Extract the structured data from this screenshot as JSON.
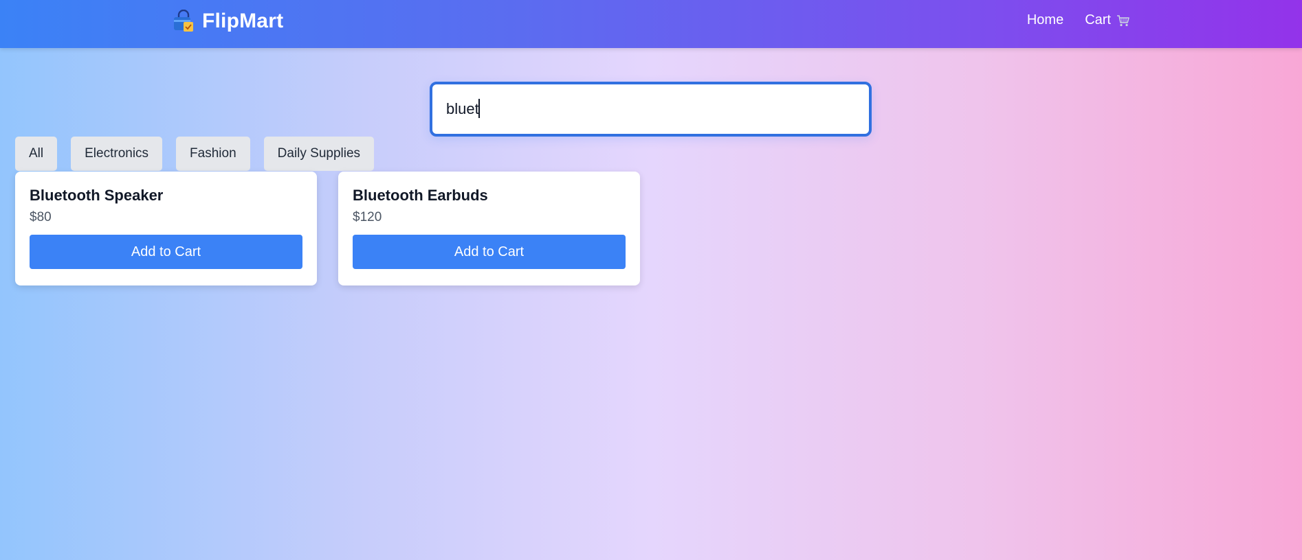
{
  "header": {
    "brand_name": "FlipMart",
    "brand_icon": "shopping-bag-icon",
    "nav": {
      "home_label": "Home",
      "cart_label": "Cart",
      "cart_icon": "shopping-cart-icon"
    }
  },
  "search": {
    "value": "bluet",
    "placeholder": ""
  },
  "filters": [
    {
      "label": "All"
    },
    {
      "label": "Electronics"
    },
    {
      "label": "Fashion"
    },
    {
      "label": "Daily Supplies"
    }
  ],
  "products": [
    {
      "name": "Bluetooth Speaker",
      "price": "$80",
      "button_label": "Add to Cart"
    },
    {
      "name": "Bluetooth Earbuds",
      "price": "$120",
      "button_label": "Add to Cart"
    }
  ],
  "colors": {
    "header_gradient_start": "#3b82f6",
    "header_gradient_end": "#9333ea",
    "accent_button": "#3b82f6",
    "search_border": "#3170e0",
    "filter_background": "#e5e7eb"
  }
}
